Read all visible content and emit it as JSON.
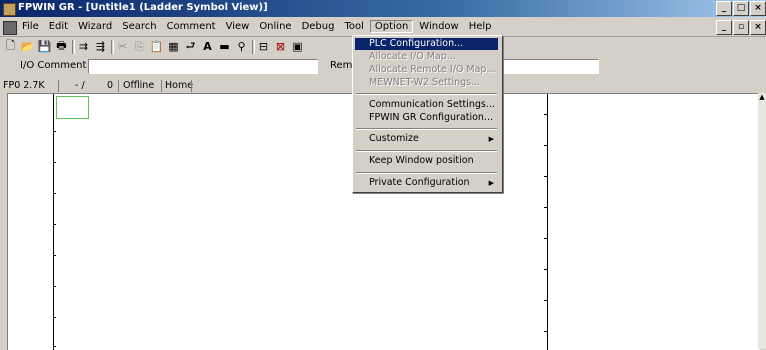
{
  "window": {
    "title": "FPWIN GR - [Untitle1 (Ladder Symbol View)]",
    "controls": [
      "_",
      "□",
      "×"
    ],
    "mdi_controls": [
      "_",
      "▫",
      "×"
    ]
  },
  "menubar": {
    "items": [
      "File",
      "Edit",
      "Wizard",
      "Search",
      "Comment",
      "View",
      "Online",
      "Debug",
      "Tool",
      "Option",
      "Window",
      "Help"
    ],
    "active": "Option"
  },
  "toolbar": {
    "icons": [
      "new-icon",
      "open-icon",
      "save-icon",
      "print-icon",
      "find-icon",
      "find-next-icon",
      "cut-icon",
      "copy-icon",
      "paste-icon",
      "insert-icon",
      "step-icon",
      "text-icon",
      "bar-icon",
      "binoculars-icon",
      "monitor-icon",
      "window-icon",
      "screen-icon"
    ]
  },
  "comment_bar": {
    "io_comment_label": "I/O Comment",
    "io_comment_value": "",
    "remark_label": "Rema",
    "remark_value": ""
  },
  "status_bar": {
    "plc": "FP0 2.7K",
    "address": "- /",
    "count": "0",
    "mode": "Offline",
    "position": "Home"
  },
  "option_menu": {
    "items": [
      {
        "label": "PLC Configuration...",
        "state": "selected"
      },
      {
        "label": "Allocate I/O Map...",
        "state": "disabled"
      },
      {
        "label": "Allocate Remote I/O Map...",
        "state": "disabled"
      },
      {
        "label": "MEWNET-W2 Settings...",
        "state": "disabled"
      },
      {
        "label": "Communication Settings...",
        "state": "enabled"
      },
      {
        "label": "FPWIN GR Configuration...",
        "state": "enabled"
      },
      {
        "label": "Customize",
        "state": "submenu"
      },
      {
        "label": "Keep Window position",
        "state": "enabled"
      },
      {
        "label": "Private Configuration",
        "state": "submenu"
      }
    ]
  }
}
